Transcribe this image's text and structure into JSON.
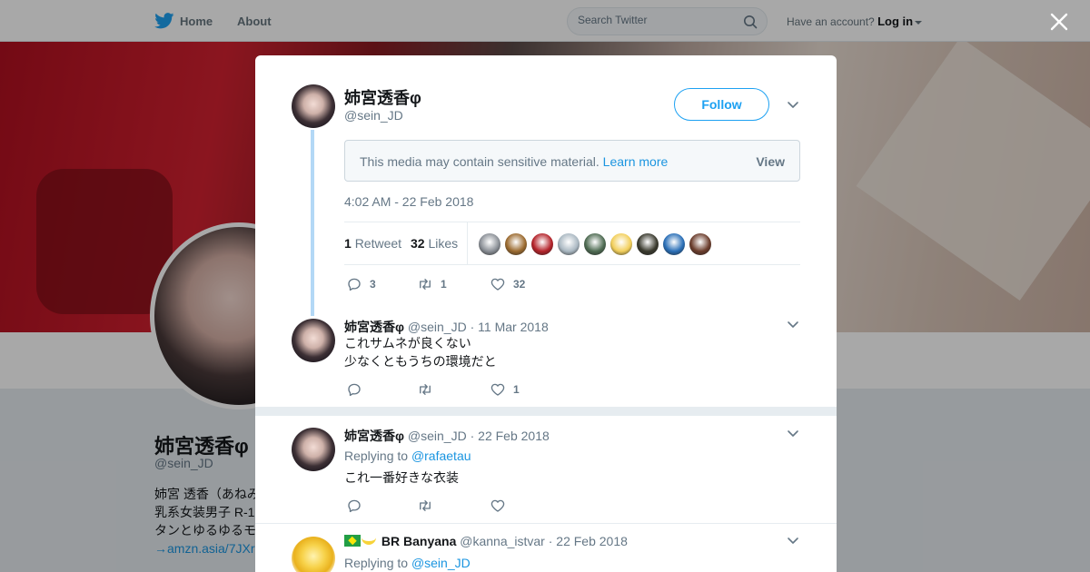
{
  "nav": {
    "home_label": "Home",
    "about_label": "About",
    "search_placeholder": "Search Twitter",
    "account_prompt": "Have an account?",
    "login_label": "Log in"
  },
  "profile_bg": {
    "name": "姉宮透香φ",
    "handle": "@sein_JD",
    "bio_lines": [
      "姉宮 透香（あねみ",
      "乳系女装男子 R-1",
      "タンとゆるゆるモ"
    ],
    "bio_link": "→amzn.asia/7JXr"
  },
  "tweet": {
    "author_name": "姉宮透香φ",
    "author_handle": "@sein_JD",
    "follow_label": "Follow",
    "sensitive_text": "This media may contain sensitive material.",
    "learn_more": "Learn more",
    "view_label": "View",
    "timestamp": "4:02 AM - 22 Feb 2018",
    "retweets_count": "1",
    "retweets_label": "Retweet",
    "likes_count": "32",
    "likes_label": "Likes",
    "likers": [
      {
        "name": "liker-1",
        "color": "#8a8f96"
      },
      {
        "name": "liker-2",
        "color": "#9b6a2f"
      },
      {
        "name": "liker-3",
        "color": "#b4232a"
      },
      {
        "name": "liker-4",
        "color": "#aab8c2"
      },
      {
        "name": "liker-5",
        "color": "#4e6b52"
      },
      {
        "name": "liker-6",
        "color": "#f2cf5b"
      },
      {
        "name": "liker-7",
        "color": "#3a3a2e"
      },
      {
        "name": "liker-8",
        "color": "#2a6fb7"
      },
      {
        "name": "liker-9",
        "color": "#6b3d2c"
      }
    ],
    "reply_count": "3",
    "retweet_count": "1",
    "like_count": "32"
  },
  "replies": [
    {
      "name": "姉宮透香φ",
      "handle": "@sein_JD",
      "date": "11 Mar 2018",
      "text_line1": "これサムネが良くない",
      "text_line2": "少なくともうちの環境だと",
      "like_count": "1"
    },
    {
      "name": "姉宮透香φ",
      "handle": "@sein_JD",
      "date": "22 Feb 2018",
      "replying_to_label": "Replying to",
      "replying_to": "@rafaetau",
      "text": "これ一番好きな衣装"
    },
    {
      "name": "BR Banyana",
      "handle": "@kanna_istvar",
      "date": "22 Feb 2018",
      "replying_to_label": "Replying to",
      "replying_to": "@sein_JD"
    }
  ],
  "separator": "·",
  "colors": {
    "twitter_blue": "#1da1f2",
    "link_blue": "#1b95e0",
    "text_gray": "#657786",
    "thread_line": "#b3d8f6"
  }
}
